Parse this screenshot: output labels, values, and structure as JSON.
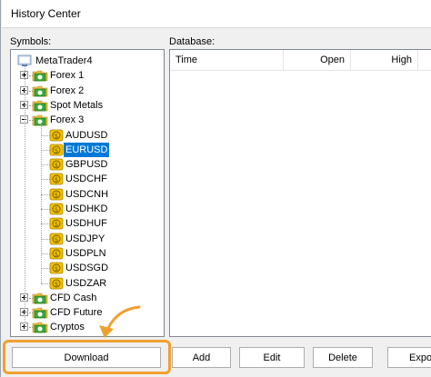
{
  "window": {
    "title": "History Center"
  },
  "symbols": {
    "label": "Symbols:",
    "root": "MetaTrader4",
    "groups": [
      {
        "label": "Forex 1",
        "expanded": false
      },
      {
        "label": "Forex 2",
        "expanded": false
      },
      {
        "label": "Spot Metals",
        "expanded": false
      },
      {
        "label": "Forex 3",
        "expanded": true,
        "items": [
          "AUDUSD",
          "EURUSD",
          "GBPUSD",
          "USDCHF",
          "USDCNH",
          "USDHKD",
          "USDHUF",
          "USDJPY",
          "USDPLN",
          "USDSGD",
          "USDZAR"
        ],
        "selected": "EURUSD"
      },
      {
        "label": "CFD Cash",
        "expanded": false
      },
      {
        "label": "CFD Future",
        "expanded": false
      },
      {
        "label": "Cryptos",
        "expanded": false
      }
    ]
  },
  "database": {
    "label": "Database:",
    "columns": [
      "Time",
      "Open",
      "High"
    ]
  },
  "buttons": {
    "download": "Download",
    "add": "Add",
    "edit": "Edit",
    "delete": "Delete",
    "export": "Expo"
  },
  "colors": {
    "selection": "#0078d7",
    "highlight": "#f0a030",
    "folder_green": "#3aa83a",
    "coin_gold": "#f2c200"
  },
  "icons": {
    "root": "terminal-icon",
    "group": "folder-icon",
    "symbol": "coin-icon"
  }
}
